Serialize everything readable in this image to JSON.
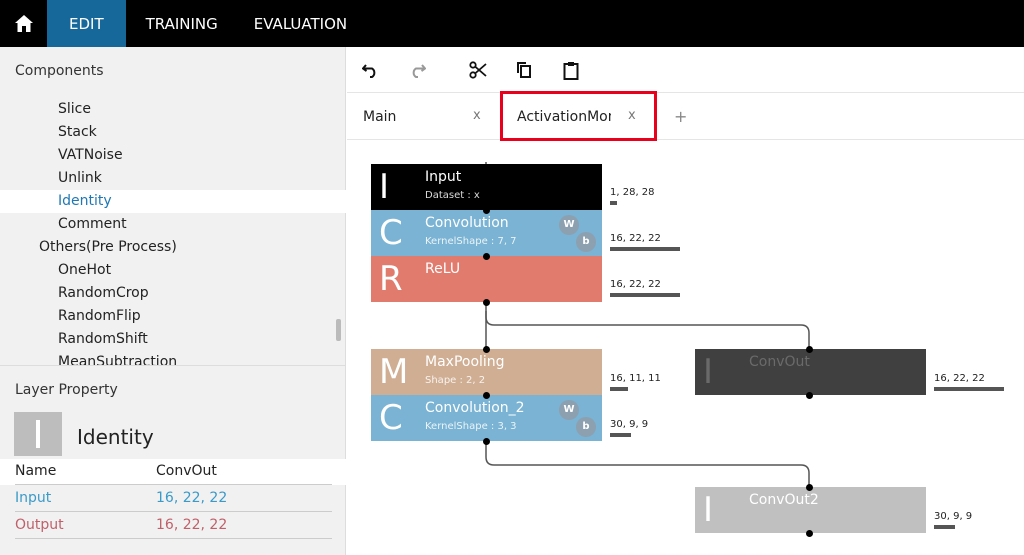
{
  "topnav": {
    "edit": "EDIT",
    "training": "TRAINING",
    "evaluation": "EVALUATION"
  },
  "components": {
    "title": "Components",
    "items": [
      {
        "label": "Slice",
        "level": 1
      },
      {
        "label": "Stack",
        "level": 1
      },
      {
        "label": "VATNoise",
        "level": 1
      },
      {
        "label": "Unlink",
        "level": 1
      },
      {
        "label": "Identity",
        "level": 1,
        "selected": true
      },
      {
        "label": "Comment",
        "level": 1
      },
      {
        "label": "Others(Pre Process)",
        "level": 0
      },
      {
        "label": "OneHot",
        "level": 1
      },
      {
        "label": "RandomCrop",
        "level": 1
      },
      {
        "label": "RandomFlip",
        "level": 1
      },
      {
        "label": "RandomShift",
        "level": 1
      },
      {
        "label": "MeanSubtraction",
        "level": 1
      }
    ]
  },
  "layer_property": {
    "title": "Layer Property",
    "icon_letter": "I",
    "type": "Identity",
    "rows": [
      {
        "key": "Name",
        "value": "ConvOut",
        "color": "#222222"
      },
      {
        "key": "Input",
        "value": "16, 22, 22",
        "color": "#3a9ac9"
      },
      {
        "key": "Output",
        "value": "16, 22, 22",
        "color": "#c0606a"
      }
    ]
  },
  "toolbar": {
    "icons": [
      "undo-icon",
      "redo-icon",
      "cut-icon",
      "copy-icon",
      "paste-icon"
    ]
  },
  "tabs": [
    {
      "label": "Main",
      "close": "x"
    },
    {
      "label": "ActivationMonitor",
      "close": "x"
    }
  ],
  "add_tab": "+",
  "nodes": [
    {
      "id": "input",
      "letter": "I",
      "name": "Input",
      "sub": "Dataset : x",
      "color": "#000000",
      "output": "1, 28, 28",
      "out_fill": 0.1
    },
    {
      "id": "conv1",
      "letter": "C",
      "name": "Convolution",
      "sub": "KernelShape : 7, 7",
      "color": "#7ab3d3",
      "output": "16, 22, 22",
      "out_fill": 1.0,
      "params": [
        "W",
        "b"
      ]
    },
    {
      "id": "relu",
      "letter": "R",
      "name": "ReLU",
      "sub": "",
      "color": "#e07b6d",
      "output": "16, 22, 22",
      "out_fill": 1.0
    },
    {
      "id": "maxpool",
      "letter": "M",
      "name": "MaxPooling",
      "sub": "Shape : 2, 2",
      "color": "#cfae93",
      "output": "16, 11, 11",
      "out_fill": 0.25
    },
    {
      "id": "conv2",
      "letter": "C",
      "name": "Convolution_2",
      "sub": "KernelShape : 3, 3",
      "color": "#7ab3d3",
      "output": "30, 9, 9",
      "out_fill": 0.3,
      "params": [
        "W",
        "b"
      ]
    },
    {
      "id": "convout",
      "letter": "I",
      "name": "ConvOut",
      "sub": "",
      "color": "#404040",
      "output": "16, 22, 22",
      "out_fill": 1.0
    },
    {
      "id": "convout2",
      "letter": "I",
      "name": "ConvOut2",
      "sub": "",
      "color": "#c0c0c0",
      "output": "30, 9, 9",
      "out_fill": 0.3
    }
  ]
}
